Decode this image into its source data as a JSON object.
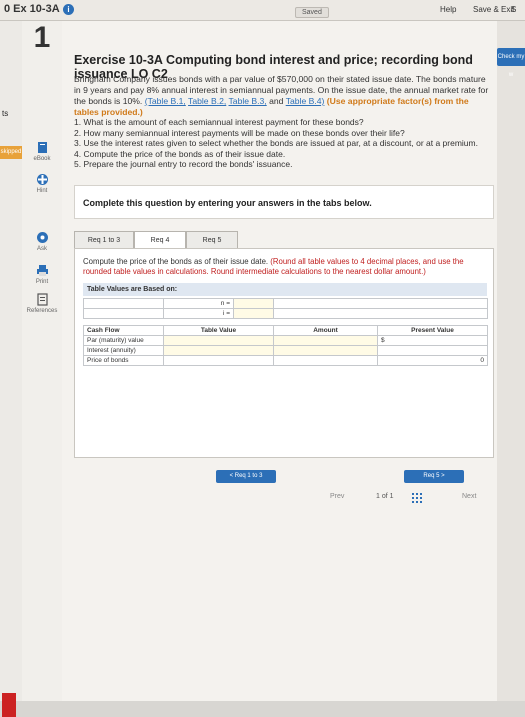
{
  "header": {
    "title": "0 Ex 10-3A",
    "info_icon": "i",
    "saved": "Saved",
    "help": "Help",
    "save_exit": "Save & Exit",
    "submit_partial": "S",
    "check_my": "Check my w"
  },
  "left_strip": {
    "ts": "ts",
    "skipped": "skipped"
  },
  "sidebar": {
    "question_number": "1",
    "items": [
      {
        "label": "eBook",
        "icon": "book-icon"
      },
      {
        "label": "Hint",
        "icon": "hint-icon"
      },
      {
        "label": "Ask",
        "icon": "ask-icon"
      },
      {
        "label": "Print",
        "icon": "print-icon"
      },
      {
        "label": "References",
        "icon": "references-icon"
      }
    ]
  },
  "exercise": {
    "title": "Exercise 10-3A Computing bond interest and price; recording bond issuance LO C2",
    "para_1": "Bringham Company issues bonds with a par value of $570,000 on their stated issue date. The bonds mature in 9 years and pay 8%",
    "para_2": "annual interest in semiannual payments. On the issue date, the annual market rate for the bonds is 10%. ",
    "link_b1": "(Table B.1,",
    "link_b2": "Table B.2,",
    "link_b3": "Table B.3,",
    "para_3_pre": "and ",
    "link_b4": "Table B.4)",
    "para_3_orange": " (Use appropriate factor(s) from the tables provided.)",
    "questions": [
      "1. What is the amount of each semiannual interest payment for these bonds?",
      "2. How many semiannual interest payments will be made on these bonds over their life?",
      "3. Use the interest rates given to select whether the bonds are issued at par, at a discount, or at a premium.",
      "4. Compute the price of the bonds as of their issue date.",
      "5. Prepare the journal entry to record the bonds' issuance."
    ]
  },
  "instruction": "Complete this question by entering your answers in the tabs below.",
  "tabs": [
    {
      "label": "Req 1 to 3"
    },
    {
      "label": "Req 4"
    },
    {
      "label": "Req 5"
    }
  ],
  "panel": {
    "compute": "Compute the price of the bonds as of their issue date.",
    "compute_red": " (Round all table values to 4 decimal places, and use the rounded table values in calculations. Round intermediate calculations to the nearest dollar amount.)",
    "table_header": "Table Values are Based on:",
    "n_label": "n =",
    "i_label": "i =",
    "col_cash_flow": "Cash Flow",
    "col_table_value": "Table Value",
    "col_amount": "Amount",
    "col_present_value": "Present Value",
    "rows": [
      {
        "label": "Par (maturity) value",
        "amount": "",
        "pv": "$"
      },
      {
        "label": "Interest (annuity)",
        "amount": "",
        "pv": ""
      },
      {
        "label": "Price of bonds",
        "amount": "",
        "pv": "0"
      }
    ],
    "prev_tab_button": "< Req 1 to 3",
    "next_tab_button": "Req 5 >"
  },
  "pager": {
    "prev": "Prev",
    "position": "1 of 1",
    "next": "Next"
  },
  "colors": {
    "accent": "#2c6fb7",
    "skipped": "#e8a23a",
    "error_text": "#c02020"
  }
}
